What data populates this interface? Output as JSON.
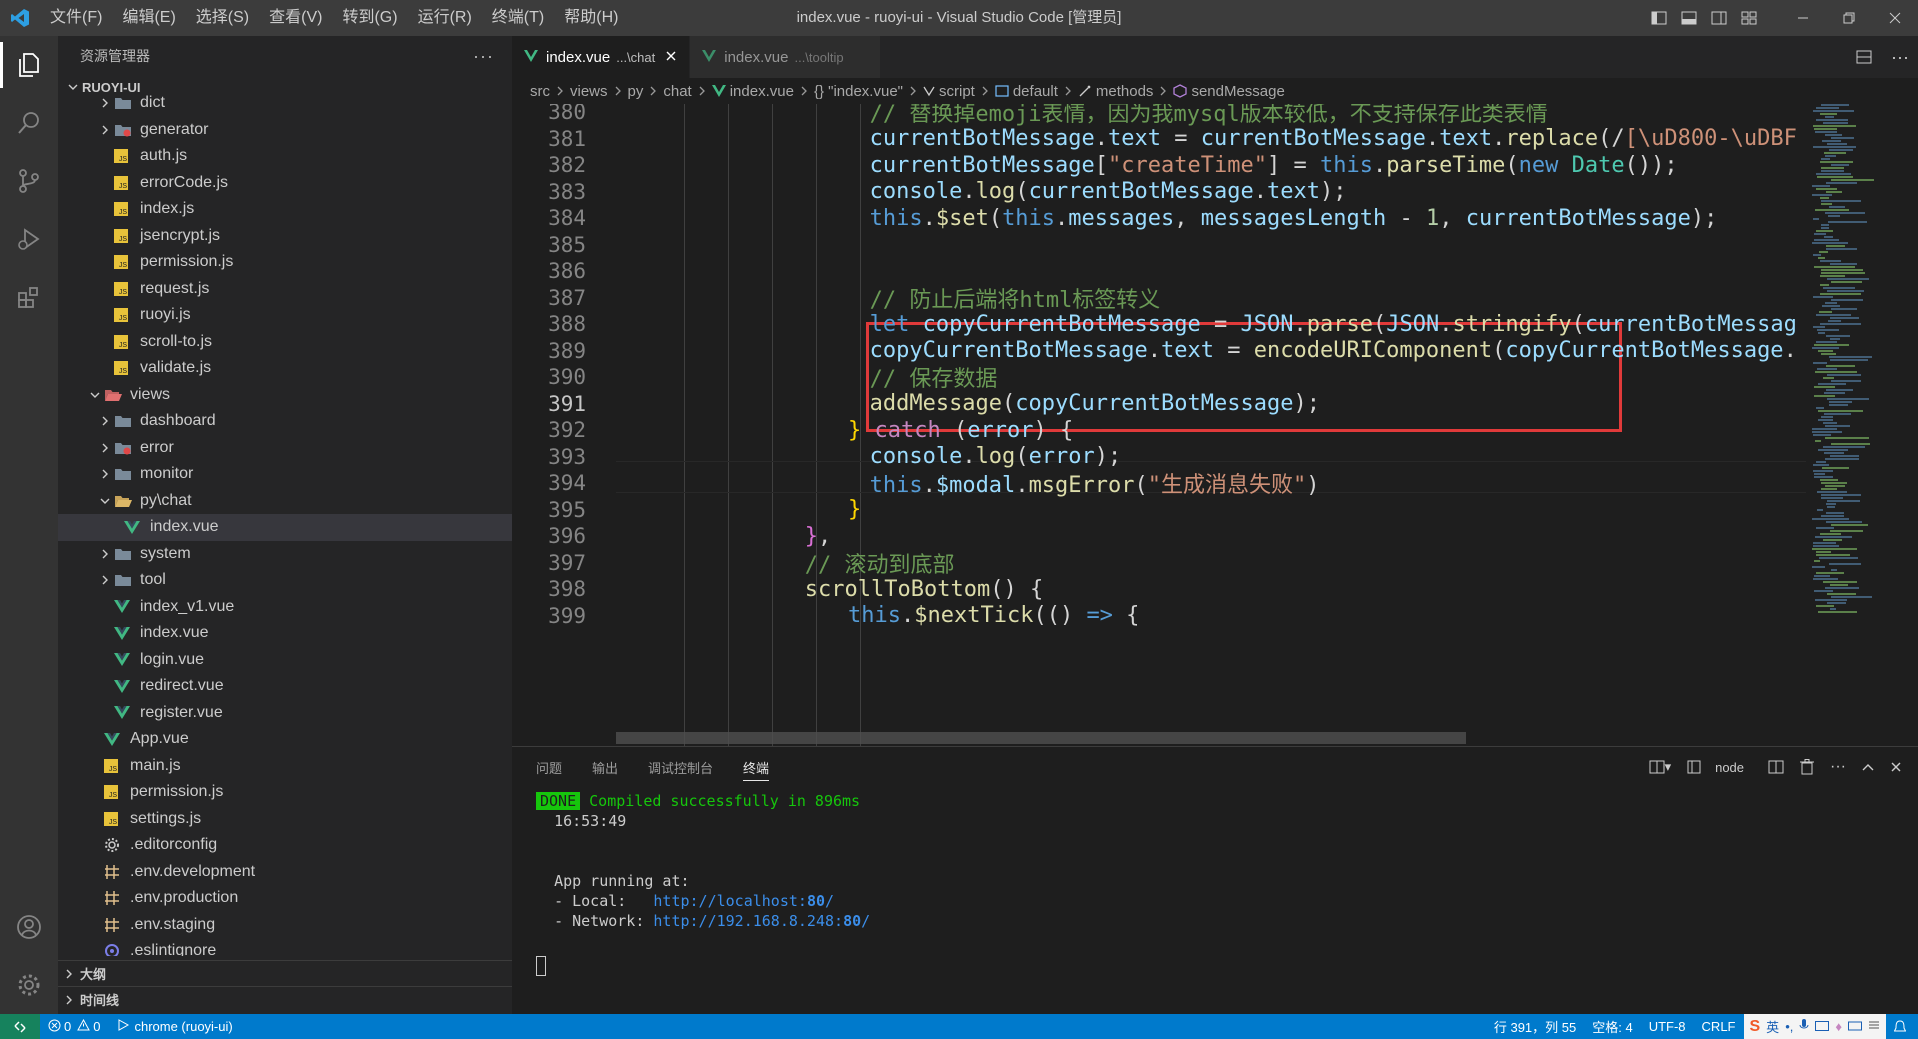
{
  "titlebar": {
    "menu": [
      "文件(F)",
      "编辑(E)",
      "选择(S)",
      "查看(V)",
      "转到(G)",
      "运行(R)",
      "终端(T)",
      "帮助(H)"
    ],
    "title": "index.vue - ruoyi-ui - Visual Studio Code [管理员]"
  },
  "sidebar": {
    "header": "资源管理器",
    "root": "RUOYI-UI",
    "items": [
      {
        "label": "dict",
        "type": "folder"
      },
      {
        "label": "generator",
        "type": "folder-red"
      },
      {
        "label": "auth.js",
        "type": "js"
      },
      {
        "label": "errorCode.js",
        "type": "js"
      },
      {
        "label": "index.js",
        "type": "js"
      },
      {
        "label": "jsencrypt.js",
        "type": "js"
      },
      {
        "label": "permission.js",
        "type": "js"
      },
      {
        "label": "request.js",
        "type": "js"
      },
      {
        "label": "ruoyi.js",
        "type": "js"
      },
      {
        "label": "scroll-to.js",
        "type": "js"
      },
      {
        "label": "validate.js",
        "type": "js"
      },
      {
        "label": "views",
        "type": "folder-open-red"
      },
      {
        "label": "dashboard",
        "type": "folder"
      },
      {
        "label": "error",
        "type": "folder-red"
      },
      {
        "label": "monitor",
        "type": "folder"
      },
      {
        "label": "py\\chat",
        "type": "folder-open"
      },
      {
        "label": "index.vue",
        "type": "vue"
      },
      {
        "label": "system",
        "type": "folder"
      },
      {
        "label": "tool",
        "type": "folder"
      },
      {
        "label": "index_v1.vue",
        "type": "vue"
      },
      {
        "label": "index.vue",
        "type": "vue"
      },
      {
        "label": "login.vue",
        "type": "vue"
      },
      {
        "label": "redirect.vue",
        "type": "vue"
      },
      {
        "label": "register.vue",
        "type": "vue"
      },
      {
        "label": "App.vue",
        "type": "vue"
      },
      {
        "label": "main.js",
        "type": "js"
      },
      {
        "label": "permission.js",
        "type": "js"
      },
      {
        "label": "settings.js",
        "type": "js"
      },
      {
        "label": ".editorconfig",
        "type": "gear"
      },
      {
        "label": ".env.development",
        "type": "env"
      },
      {
        "label": ".env.production",
        "type": "env"
      },
      {
        "label": ".env.staging",
        "type": "env"
      },
      {
        "label": ".eslintignore",
        "type": "eslint"
      }
    ],
    "outline": "大纲",
    "timeline": "时间线"
  },
  "tabs": [
    {
      "label": "index.vue",
      "sub": "...\\chat",
      "active": true
    },
    {
      "label": "index.vue",
      "sub": "...\\tooltip",
      "active": false
    }
  ],
  "breadcrumb": [
    "src",
    "views",
    "py",
    "chat",
    "index.vue",
    "{} \"index.vue\"",
    "script",
    "default",
    "methods",
    "sendMessage"
  ],
  "code_lines": [
    {
      "n": "380",
      "indent": 22,
      "tokens": [
        [
          "c",
          "// 替换掉emoji表情，因为我mysql版本较低，不支持保存此类表情"
        ]
      ]
    },
    {
      "n": "381",
      "indent": 22,
      "tokens": [
        [
          "v",
          "currentBotMessage"
        ],
        [
          "p",
          "."
        ],
        [
          "v",
          "text"
        ],
        [
          "p",
          " = "
        ],
        [
          "v",
          "currentBotMessage"
        ],
        [
          "p",
          "."
        ],
        [
          "v",
          "text"
        ],
        [
          "p",
          "."
        ],
        [
          "f",
          "replace"
        ],
        [
          "p",
          "(/"
        ],
        [
          "r",
          "[\\uD800-\\uDBF"
        ]
      ]
    },
    {
      "n": "382",
      "indent": 22,
      "tokens": [
        [
          "v",
          "currentBotMessage"
        ],
        [
          "p",
          "["
        ],
        [
          "s",
          "\"createTime\""
        ],
        [
          "p",
          "] = "
        ],
        [
          "k",
          "this"
        ],
        [
          "p",
          "."
        ],
        [
          "f",
          "parseTime"
        ],
        [
          "p",
          "("
        ],
        [
          "k",
          "new"
        ],
        [
          "p",
          " "
        ],
        [
          "t",
          "Date"
        ],
        [
          "p",
          "());"
        ]
      ]
    },
    {
      "n": "383",
      "indent": 22,
      "tokens": [
        [
          "v",
          "console"
        ],
        [
          "p",
          "."
        ],
        [
          "f",
          "log"
        ],
        [
          "p",
          "("
        ],
        [
          "v",
          "currentBotMessage"
        ],
        [
          "p",
          "."
        ],
        [
          "v",
          "text"
        ],
        [
          "p",
          ");"
        ]
      ]
    },
    {
      "n": "384",
      "indent": 22,
      "tokens": [
        [
          "k",
          "this"
        ],
        [
          "p",
          "."
        ],
        [
          "f",
          "$set"
        ],
        [
          "p",
          "("
        ],
        [
          "k",
          "this"
        ],
        [
          "p",
          "."
        ],
        [
          "v",
          "messages"
        ],
        [
          "p",
          ", "
        ],
        [
          "v",
          "messagesLength"
        ],
        [
          "p",
          " - "
        ],
        [
          "n",
          "1"
        ],
        [
          "p",
          ", "
        ],
        [
          "v",
          "currentBotMessage"
        ],
        [
          "p",
          ");"
        ]
      ]
    },
    {
      "n": "385",
      "indent": 22,
      "tokens": []
    },
    {
      "n": "386",
      "indent": 22,
      "tokens": []
    },
    {
      "n": "387",
      "indent": 22,
      "tokens": [
        [
          "c",
          "// 防止后端将html标签转义"
        ]
      ]
    },
    {
      "n": "388",
      "indent": 22,
      "tokens": [
        [
          "k",
          "let"
        ],
        [
          "p",
          " "
        ],
        [
          "v",
          "copyCurrentBotMessage"
        ],
        [
          "p",
          " = "
        ],
        [
          "v",
          "JSON"
        ],
        [
          "p",
          "."
        ],
        [
          "f",
          "parse"
        ],
        [
          "p",
          "("
        ],
        [
          "v",
          "JSON"
        ],
        [
          "p",
          "."
        ],
        [
          "f",
          "stringify"
        ],
        [
          "p",
          "("
        ],
        [
          "v",
          "currentBotMessag"
        ]
      ]
    },
    {
      "n": "389",
      "indent": 22,
      "tokens": [
        [
          "v",
          "copyCurrentBotMessage"
        ],
        [
          "p",
          "."
        ],
        [
          "v",
          "text"
        ],
        [
          "p",
          " = "
        ],
        [
          "f",
          "encodeURIComponent"
        ],
        [
          "p",
          "("
        ],
        [
          "v",
          "copyCurrentBotMessage"
        ],
        [
          "p",
          "."
        ]
      ]
    },
    {
      "n": "390",
      "indent": 22,
      "tokens": [
        [
          "c",
          "// 保存数据"
        ]
      ]
    },
    {
      "n": "391",
      "indent": 22,
      "tokens": [
        [
          "f",
          "addMessage"
        ],
        [
          "p",
          "("
        ],
        [
          "v",
          "copyCurrentBotMessage"
        ],
        [
          "p",
          ");"
        ]
      ]
    },
    {
      "n": "392",
      "indent": 20,
      "tokens": [
        [
          "y",
          "}"
        ],
        [
          "p",
          " "
        ],
        [
          "k2",
          "catch"
        ],
        [
          "p",
          " ("
        ],
        [
          "v",
          "error"
        ],
        [
          "p",
          ") {"
        ]
      ]
    },
    {
      "n": "393",
      "indent": 22,
      "tokens": [
        [
          "v",
          "console"
        ],
        [
          "p",
          "."
        ],
        [
          "f",
          "log"
        ],
        [
          "p",
          "("
        ],
        [
          "v",
          "error"
        ],
        [
          "p",
          ");"
        ]
      ]
    },
    {
      "n": "394",
      "indent": 22,
      "tokens": [
        [
          "k",
          "this"
        ],
        [
          "p",
          "."
        ],
        [
          "v",
          "$modal"
        ],
        [
          "p",
          "."
        ],
        [
          "f",
          "msgError"
        ],
        [
          "p",
          "("
        ],
        [
          "s",
          "\"生成消息失败\""
        ],
        [
          "p",
          ")"
        ]
      ]
    },
    {
      "n": "395",
      "indent": 20,
      "tokens": [
        [
          "y",
          "}"
        ]
      ]
    },
    {
      "n": "396",
      "indent": 16,
      "tokens": [
        [
          "y2",
          "}"
        ],
        [
          "p",
          ","
        ]
      ]
    },
    {
      "n": "397",
      "indent": 16,
      "tokens": [
        [
          "c",
          "// 滚动到底部"
        ]
      ]
    },
    {
      "n": "398",
      "indent": 16,
      "tokens": [
        [
          "f",
          "scrollToBottom"
        ],
        [
          "p",
          "() {"
        ]
      ]
    },
    {
      "n": "399",
      "indent": 20,
      "tokens": [
        [
          "k",
          "this"
        ],
        [
          "p",
          "."
        ],
        [
          "f",
          "$nextTick"
        ],
        [
          "p",
          "(() "
        ],
        [
          "k",
          "=>"
        ],
        [
          "p",
          " {"
        ]
      ]
    }
  ],
  "current_line": "391",
  "panel": {
    "tabs": [
      "问题",
      "输出",
      "调试控制台",
      "终端"
    ],
    "active_tab": "终端",
    "terminal_name": "node",
    "terminal": {
      "done_badge": "DONE",
      "compiled": "Compiled successfully in 896ms",
      "time": "16:53:49",
      "running": "App running at:",
      "local_label": "- Local:   ",
      "local_url_prefix": "http://localhost:",
      "local_port": "80",
      "local_url_suffix": "/",
      "network_label": "- Network: ",
      "network_url_prefix": "http://192.168.8.248:",
      "network_port": "80",
      "network_url_suffix": "/"
    }
  },
  "statusbar": {
    "errors": "0",
    "warnings": "0",
    "debug": "chrome (ruoyi-ui)",
    "position": "行 391，列 55",
    "spaces": "空格: 4",
    "encoding": "UTF-8",
    "eol": "CRLF",
    "ime": "英"
  },
  "colors": {
    "accent": "#007acc",
    "comment": "#6a9955",
    "keyword": "#569cd6",
    "variable": "#9cdcfe",
    "function": "#dcdcaa",
    "string": "#ce9178",
    "number": "#b5cea8",
    "control": "#c586c0",
    "bracket_yellow": "#ffd700",
    "bracket_pink": "#da70d6",
    "redbox": "#e03a3a"
  }
}
